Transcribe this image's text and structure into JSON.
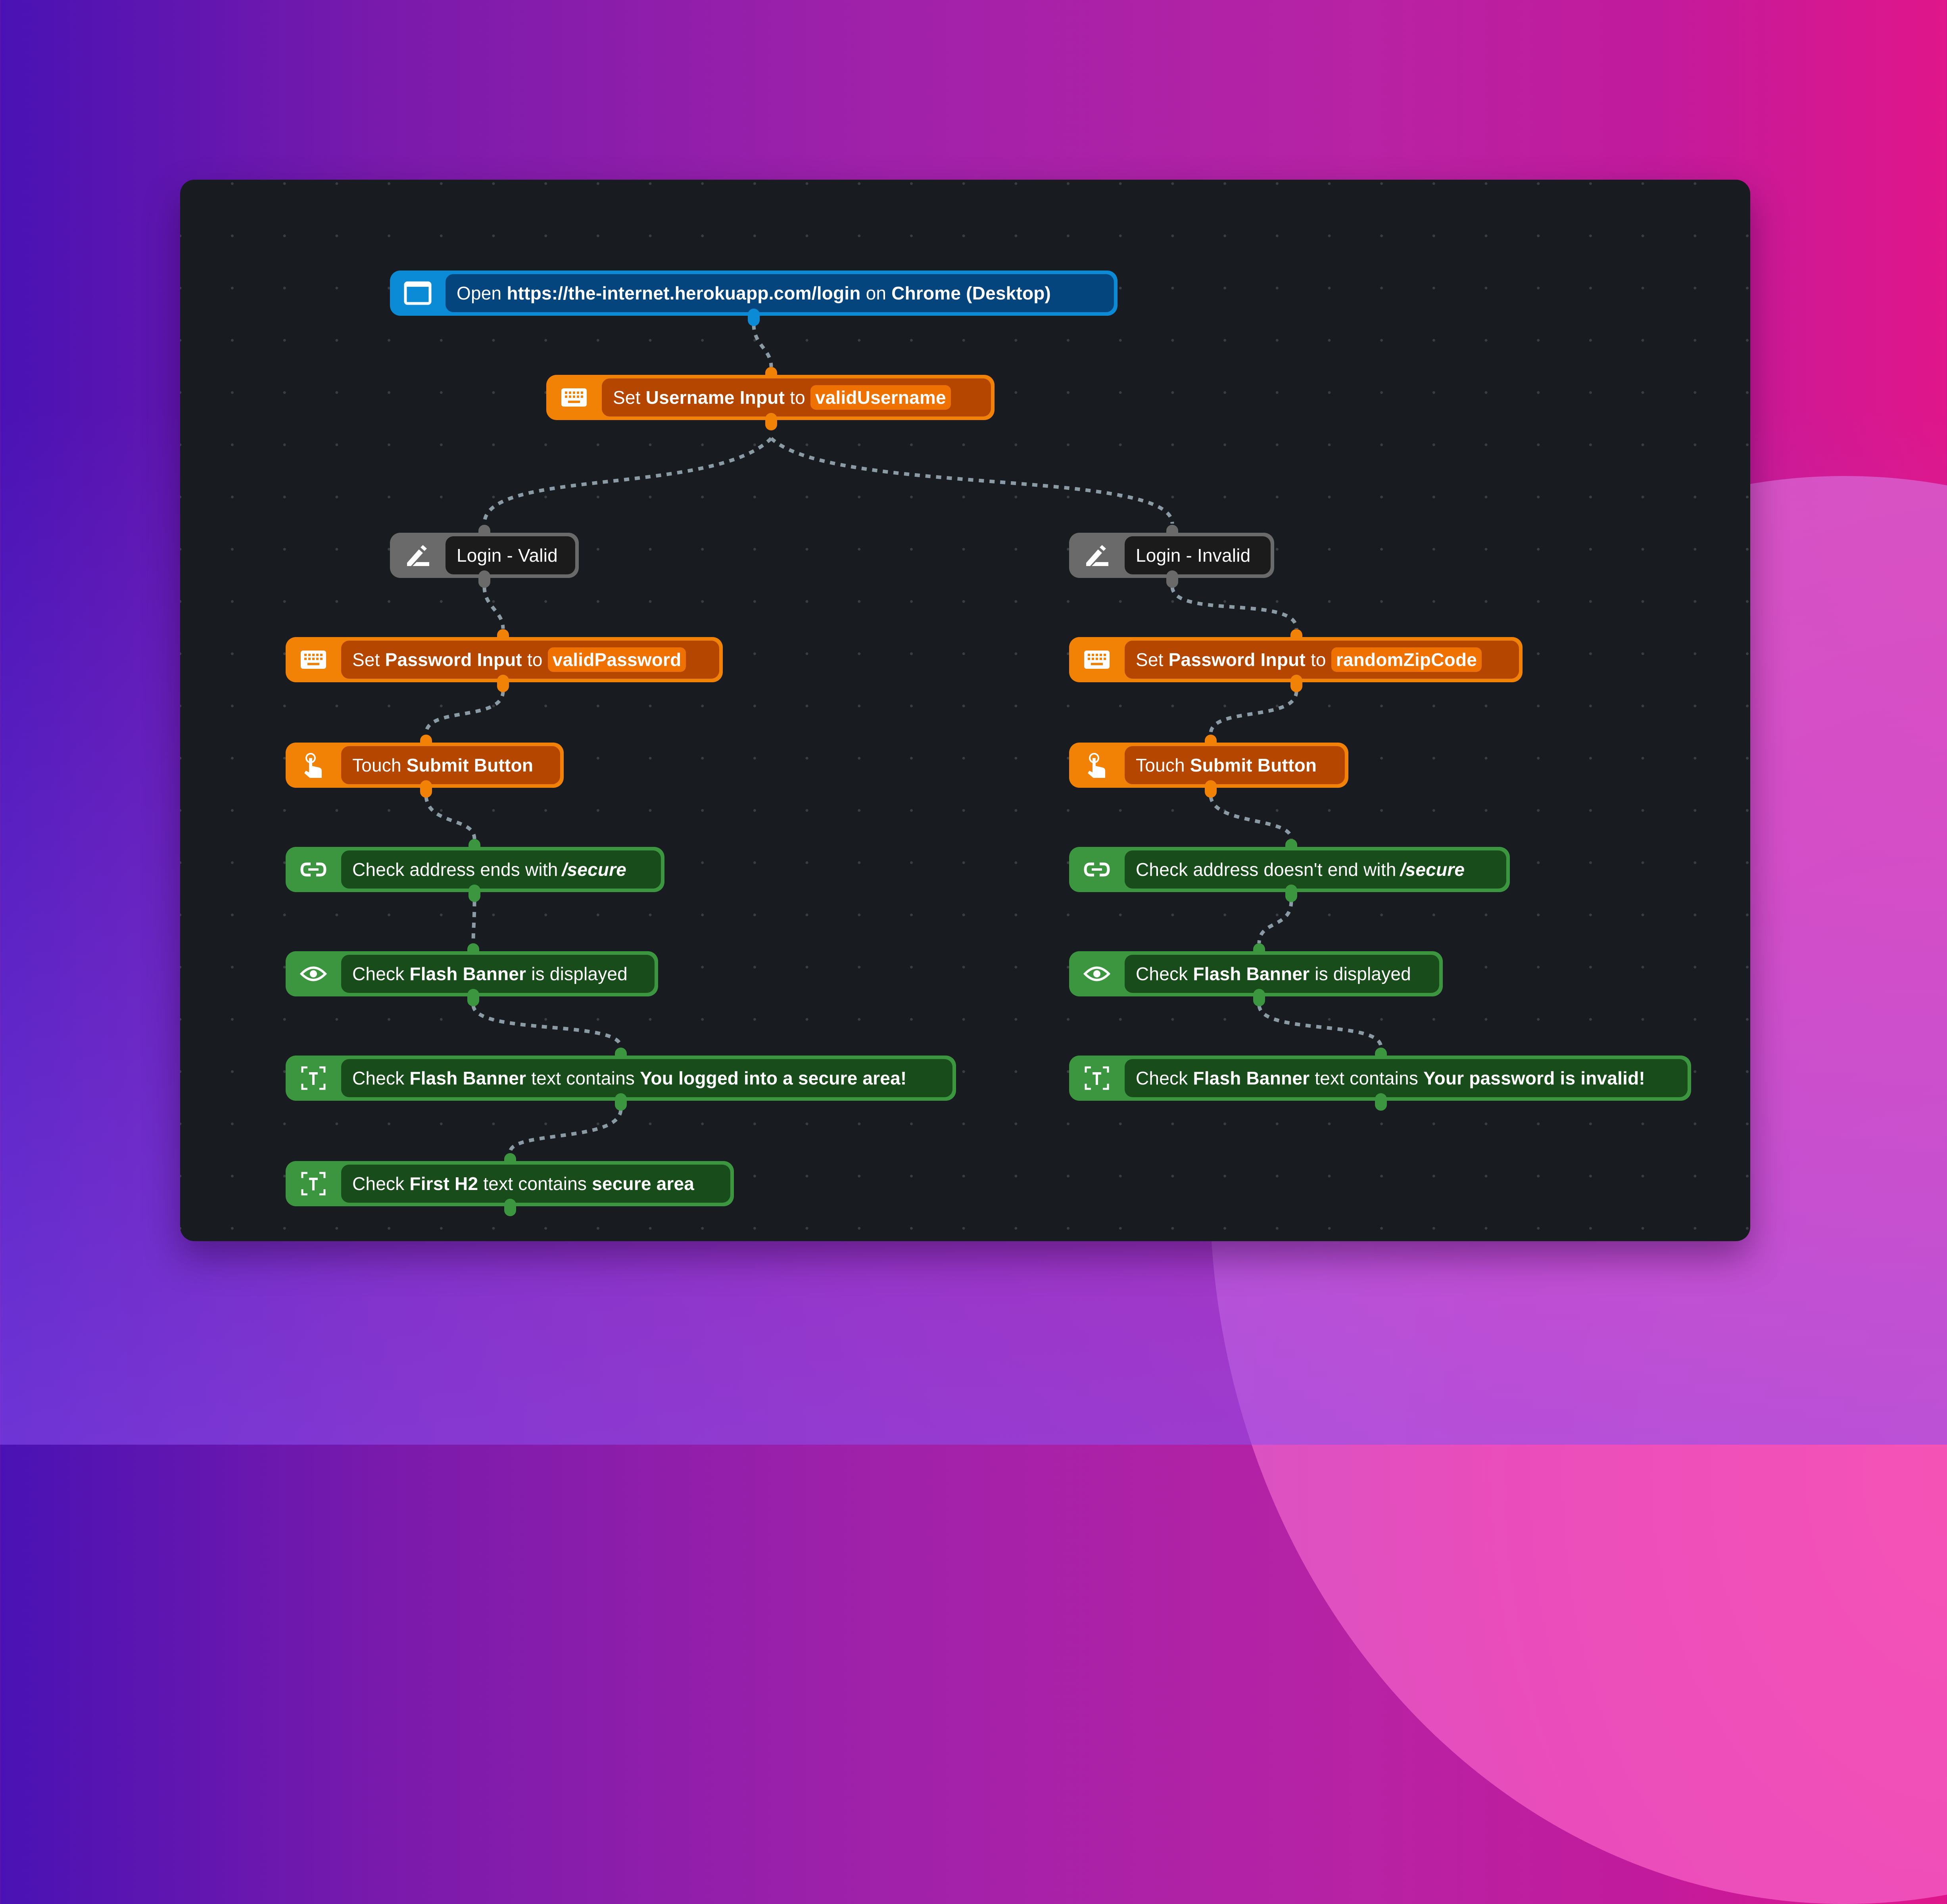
{
  "canvas": {
    "background_colors": [
      "#4a12b4",
      "#a021aa",
      "#e0168a",
      "#f756b8"
    ],
    "panel_color": "#181b1f",
    "connector_color": "#8a9ba5"
  },
  "colors": {
    "navigate": "#0b8ad6",
    "input": "#f28205",
    "group": "#6a6a6a",
    "assertion": "#3b963f"
  },
  "nodes": {
    "open": {
      "icon": "browser-window-icon",
      "verb": "Open",
      "url": "https://the-internet.herokuapp.com/login",
      "joiner": "on",
      "target": "Chrome (Desktop)"
    },
    "set_username": {
      "icon": "keyboard-icon",
      "verb": "Set",
      "element": "Username Input",
      "joiner": "to",
      "value": "validUsername"
    },
    "login_valid": {
      "icon": "edit-pencil-icon",
      "label": "Login - Valid"
    },
    "login_invalid": {
      "icon": "edit-pencil-icon",
      "label": "Login - Invalid"
    },
    "valid_branch": [
      {
        "type": "input",
        "icon": "keyboard-icon",
        "verb": "Set",
        "element": "Password Input",
        "joiner": "to",
        "value": "validPassword"
      },
      {
        "type": "touch",
        "icon": "touch-hand-icon",
        "verb": "Touch",
        "element": "Submit Button"
      },
      {
        "type": "address",
        "icon": "link-icon",
        "verb": "Check address ends with",
        "value": "/secure"
      },
      {
        "type": "visible",
        "icon": "eye-icon",
        "verb": "Check",
        "element": "Flash Banner",
        "tail": "is displayed"
      },
      {
        "type": "text",
        "icon": "text-scan-icon",
        "verb": "Check",
        "element": "Flash Banner",
        "joiner": "text contains",
        "value": "You logged into a secure area!"
      },
      {
        "type": "text",
        "icon": "text-scan-icon",
        "verb": "Check",
        "element": "First H2",
        "joiner": "text contains",
        "value": "secure area"
      }
    ],
    "invalid_branch": [
      {
        "type": "input",
        "icon": "keyboard-icon",
        "verb": "Set",
        "element": "Password Input",
        "joiner": "to",
        "value": "randomZipCode"
      },
      {
        "type": "touch",
        "icon": "touch-hand-icon",
        "verb": "Touch",
        "element": "Submit Button"
      },
      {
        "type": "address",
        "icon": "link-icon",
        "verb": "Check address doesn't end with",
        "value": "/secure"
      },
      {
        "type": "visible",
        "icon": "eye-icon",
        "verb": "Check",
        "element": "Flash Banner",
        "tail": "is displayed"
      },
      {
        "type": "text",
        "icon": "text-scan-icon",
        "verb": "Check",
        "element": "Flash Banner",
        "joiner": "text contains",
        "value": "Your password is invalid!"
      }
    ]
  }
}
